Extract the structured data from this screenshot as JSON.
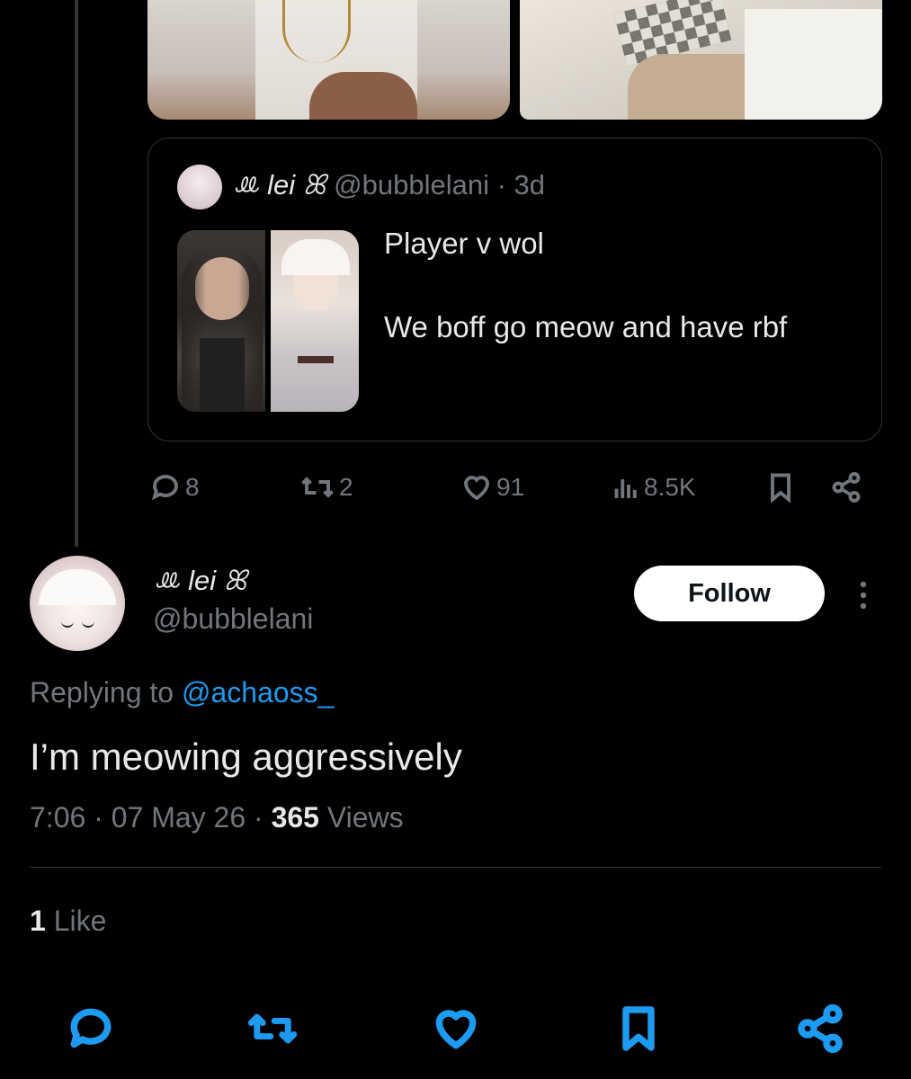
{
  "quoted_tweet": {
    "display_name": "ꔛ lei ꕤ",
    "handle": "@bubblelani",
    "time": "· 3d",
    "text_line1": "Player v wol",
    "text_line2": "We boff go meow and have rbf"
  },
  "parent_actions": {
    "replies": "8",
    "retweets": "2",
    "likes": "91",
    "views": "8.5K"
  },
  "author": {
    "display_name": "ꔛ lei ꕤ",
    "handle": "@bubblelani",
    "follow_label": "Follow"
  },
  "tweet": {
    "replying_prefix": "Replying to ",
    "replying_to": "@achaoss_",
    "text": "I’m meowing aggressively",
    "time": "7:06 · 07 May 26 · ",
    "views_count": "365",
    "views_label": " Views"
  },
  "engagement": {
    "like_count": "1",
    "like_label": " Like"
  },
  "icons": {
    "accent_color": "#1d9bf0",
    "muted_color": "#71767b",
    "bottom_bar": [
      "reply-icon",
      "retweet-icon",
      "like-icon",
      "bookmark-icon",
      "share-icon"
    ]
  }
}
